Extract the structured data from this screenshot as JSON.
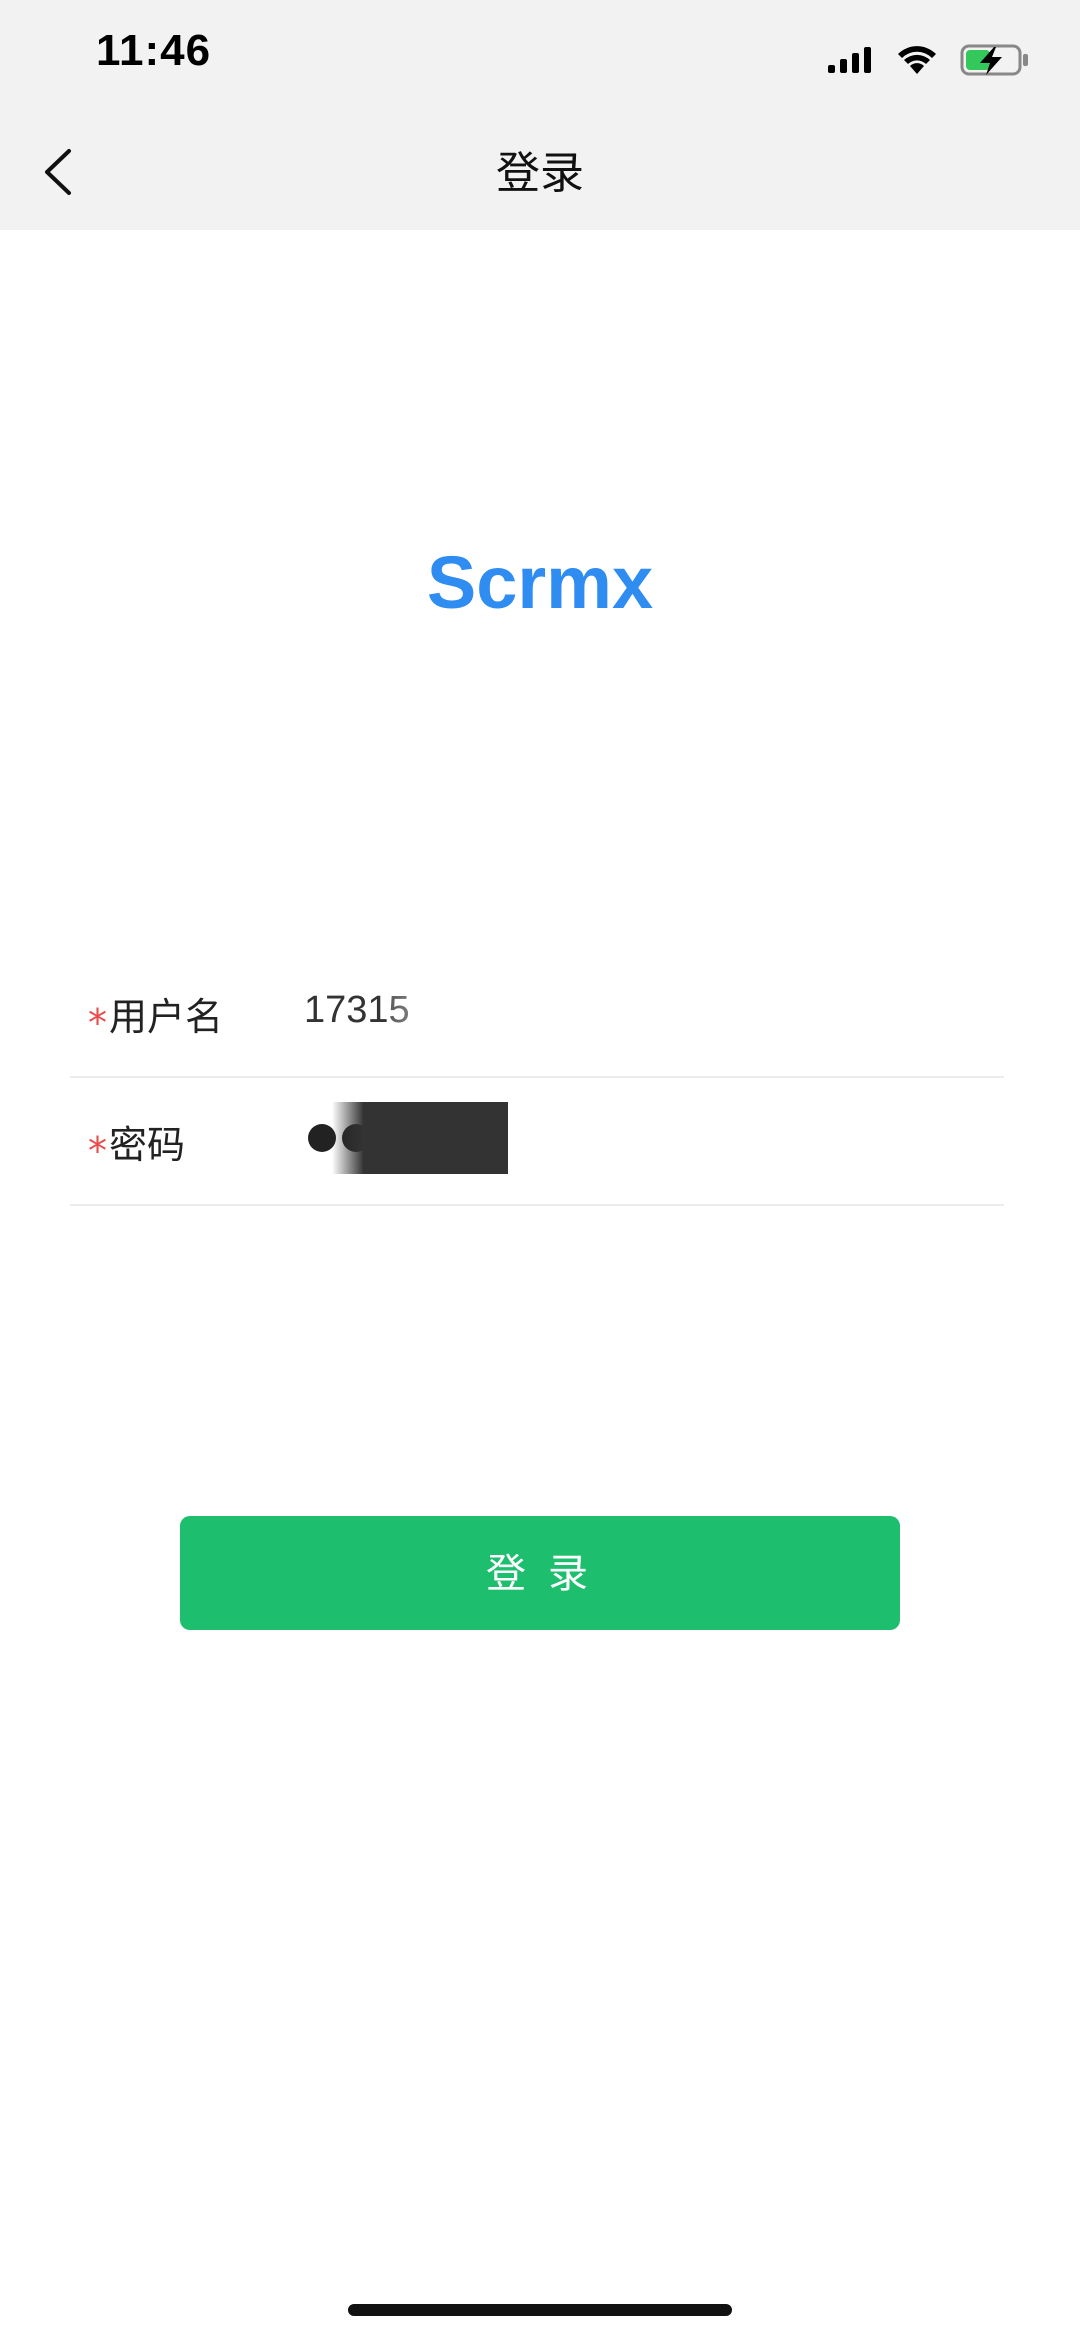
{
  "status_bar": {
    "time": "11:46",
    "icons": [
      "signal-icon",
      "wifi-icon",
      "battery-charging-icon"
    ],
    "battery_color": "#34c759"
  },
  "nav": {
    "title": "登录",
    "back_icon": "chevron-left-icon"
  },
  "brand": {
    "name": "Scrmx",
    "color": "#2f8cf0"
  },
  "form": {
    "username": {
      "required_mark": "*",
      "label": "用户名",
      "value": "17315"
    },
    "password": {
      "required_mark": "*",
      "label": "密码",
      "masked": true
    }
  },
  "actions": {
    "login_label": "登录",
    "login_color": "#1dbf6e"
  }
}
